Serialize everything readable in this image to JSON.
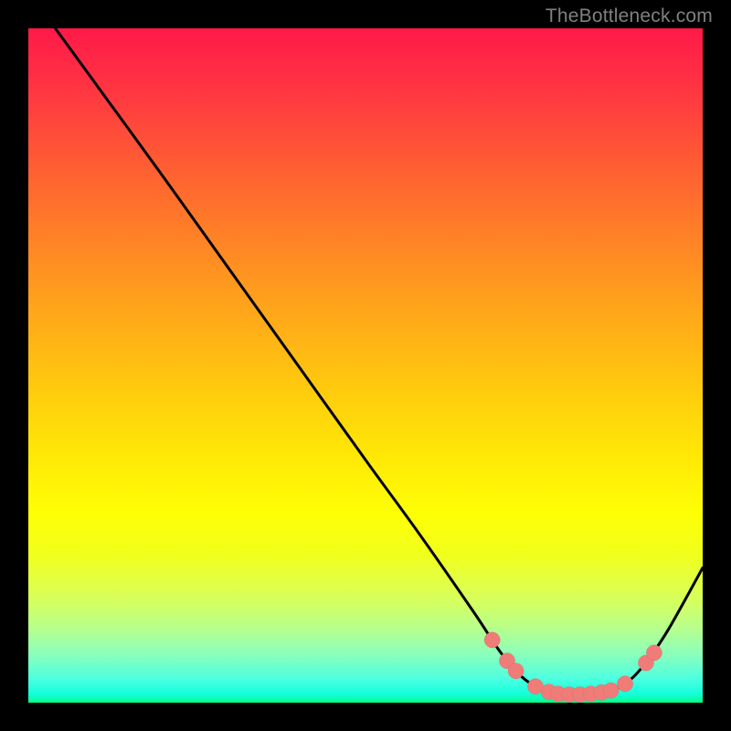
{
  "watermark": "TheBottleneck.com",
  "colors": {
    "frame": "#000000",
    "curve_stroke": "#000000",
    "marker_fill": "#ef7c78",
    "marker_stroke": "#df6d69"
  },
  "chart_data": {
    "type": "line",
    "title": "",
    "xlabel": "",
    "ylabel": "",
    "xlim": [
      0,
      100
    ],
    "ylim": [
      0,
      100
    ],
    "grid": false,
    "curve": [
      {
        "x": 4.0,
        "y": 100.0
      },
      {
        "x": 12.0,
        "y": 89.0
      },
      {
        "x": 20.0,
        "y": 78.0
      },
      {
        "x": 30.0,
        "y": 64.0
      },
      {
        "x": 40.0,
        "y": 50.0
      },
      {
        "x": 50.0,
        "y": 36.0
      },
      {
        "x": 58.0,
        "y": 25.0
      },
      {
        "x": 66.0,
        "y": 13.5
      },
      {
        "x": 70.0,
        "y": 7.5
      },
      {
        "x": 73.0,
        "y": 4.0
      },
      {
        "x": 76.0,
        "y": 2.0
      },
      {
        "x": 80.0,
        "y": 1.2
      },
      {
        "x": 84.0,
        "y": 1.2
      },
      {
        "x": 87.0,
        "y": 2.0
      },
      {
        "x": 89.5,
        "y": 3.6
      },
      {
        "x": 92.0,
        "y": 6.5
      },
      {
        "x": 95.0,
        "y": 11.0
      },
      {
        "x": 100.0,
        "y": 20.0
      }
    ],
    "markers": [
      {
        "x": 68.8,
        "y": 9.3
      },
      {
        "x": 71.0,
        "y": 6.2
      },
      {
        "x": 72.3,
        "y": 4.7
      },
      {
        "x": 75.2,
        "y": 2.4
      },
      {
        "x": 77.2,
        "y": 1.6
      },
      {
        "x": 78.6,
        "y": 1.3
      },
      {
        "x": 80.2,
        "y": 1.2
      },
      {
        "x": 81.8,
        "y": 1.2
      },
      {
        "x": 83.4,
        "y": 1.3
      },
      {
        "x": 85.0,
        "y": 1.5
      },
      {
        "x": 86.4,
        "y": 1.8
      },
      {
        "x": 88.5,
        "y": 2.8
      },
      {
        "x": 91.6,
        "y": 5.9
      },
      {
        "x": 92.8,
        "y": 7.4
      }
    ]
  }
}
